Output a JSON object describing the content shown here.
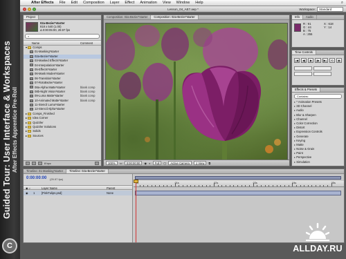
{
  "band": {
    "title": "Guided Tour: User Interface & Workspaces",
    "subtitle": "After Effects Apprentice Pre-Roll",
    "logo": "C"
  },
  "menubar": {
    "app": "After Effects",
    "items": [
      "File",
      "Edit",
      "Composition",
      "Layer",
      "Effect",
      "Animation",
      "View",
      "Window",
      "Help"
    ]
  },
  "document": {
    "title": "Lesson_04_AE7.aep *",
    "workspace_label": "Workspace:",
    "workspace_value": "Standard"
  },
  "project": {
    "tab": "Project",
    "comp_name": "02a-Bezier*starter",
    "comp_size": "818 x 540 (1.00)",
    "comp_duration": "Δ 0:00:05:00, 29.97 fps",
    "search_placeholder": "",
    "col_name": "Name",
    "col_comment": "Comment",
    "items": [
      {
        "name": "Comps",
        "type": "folder",
        "comment": "",
        "indent": 0
      },
      {
        "name": "01-Masking*starter",
        "type": "comp",
        "comment": "",
        "indent": 1
      },
      {
        "name": "02a-Bezier*starter",
        "type": "comp",
        "comment": "",
        "indent": 1,
        "selected": true
      },
      {
        "name": "03-Masked Effects*starter",
        "type": "comp",
        "comment": "",
        "indent": 1
      },
      {
        "name": "04-Interpolation*starter",
        "type": "comp",
        "comment": "",
        "indent": 1
      },
      {
        "name": "05-Effects*starter",
        "type": "comp",
        "comment": "",
        "indent": 1
      },
      {
        "name": "06-Mask Modes*starter",
        "type": "comp",
        "comment": "",
        "indent": 1
      },
      {
        "name": "06-Transition*starter",
        "type": "comp",
        "comment": "",
        "indent": 1
      },
      {
        "name": "07-RotoBezier*starter",
        "type": "comp",
        "comment": "",
        "indent": 1
      },
      {
        "name": "08a-Alpha Matte*starter",
        "type": "comp",
        "comment": "blank comp",
        "indent": 1
      },
      {
        "name": "08b-Night Vision*starter",
        "type": "comp",
        "comment": "blank comp",
        "indent": 1
      },
      {
        "name": "09-Luma Matte*starter",
        "type": "comp",
        "comment": "blank comp",
        "indent": 1
      },
      {
        "name": "10-Animated Matte*starter",
        "type": "comp",
        "comment": "blank comp",
        "indent": 1
      },
      {
        "name": "11-Stencil Luma*starter",
        "type": "comp",
        "comment": "",
        "indent": 1
      },
      {
        "name": "12-Stencil Alpha*starter",
        "type": "comp",
        "comment": "",
        "indent": 1
      },
      {
        "name": "Comps_Finished",
        "type": "folder",
        "comment": "",
        "indent": 0
      },
      {
        "name": "Idea Corner",
        "type": "folder",
        "comment": "",
        "indent": 0
      },
      {
        "name": "Quizzler",
        "type": "folder",
        "comment": "",
        "indent": 0
      },
      {
        "name": "Quizzler Solutions",
        "type": "folder",
        "comment": "",
        "indent": 0
      },
      {
        "name": "Solids",
        "type": "folder",
        "comment": "",
        "indent": 0
      },
      {
        "name": "Sources",
        "type": "folder",
        "comment": "",
        "indent": 0
      }
    ]
  },
  "composition": {
    "tabs": [
      "Composition: 02a-Bezier*starter",
      "Composition: 02a-Bezier*starter"
    ],
    "zoom": "100%",
    "timecode": "0:00:00:00",
    "resolution": "Full",
    "camera": "Active Camera",
    "view": "1 View"
  },
  "info": {
    "tabs": [
      "Info",
      "Audio"
    ],
    "R": "R : 91",
    "G": "G : 44",
    "B": "B : 75",
    "A": "A : 255",
    "X": "X : 618",
    "Y": "Y : 14"
  },
  "time_controls": {
    "tab": "Time Controls",
    "buttons": [
      "|◀",
      "◀|",
      "▶",
      "|▶",
      "▶|",
      "⟲",
      "◉"
    ]
  },
  "effects": {
    "tab": "Effects & Presets",
    "contains_label": "Contains:",
    "categories": [
      "* Animation Presets",
      "3D Channel",
      "Audio",
      "Blur & Sharpen",
      "Channel",
      "Color Correction",
      "Distort",
      "Expression Controls",
      "Generate",
      "Keying",
      "Matte",
      "Noise & Grain",
      "Paint",
      "Perspective",
      "Simulation"
    ]
  },
  "timeline": {
    "tabs": [
      "Timeline: 01-Masking*starter",
      "Timeline: 02a-Bezier*starter"
    ],
    "current_time": "0:00:00:00",
    "fps": "(29.97 fps)",
    "col_layer": "Layer Name",
    "col_parent": "Parent",
    "layer_index": "1",
    "layer_name": "[PinkTulips.psd]",
    "layer_parent": "None",
    "ruler": [
      "0s",
      "01s",
      "02s",
      "03s",
      "04s",
      "05s"
    ]
  },
  "watermark": {
    "text": "ALLDAY.RU"
  }
}
